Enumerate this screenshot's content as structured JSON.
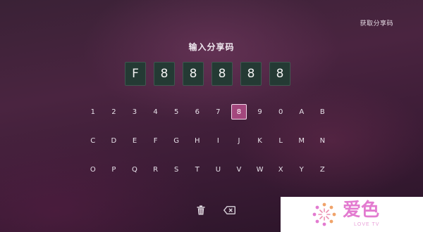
{
  "header": {
    "get_code_link": "获取分享码"
  },
  "title": "输入分享码",
  "code_boxes": [
    "F",
    "8",
    "8",
    "8",
    "8",
    "8"
  ],
  "keyboard": {
    "rows": [
      [
        "1",
        "2",
        "3",
        "4",
        "5",
        "6",
        "7",
        "8",
        "9",
        "0",
        "A",
        "B"
      ],
      [
        "C",
        "D",
        "E",
        "F",
        "G",
        "H",
        "I",
        "J",
        "K",
        "L",
        "M",
        "N"
      ],
      [
        "O",
        "P",
        "Q",
        "R",
        "S",
        "T",
        "U",
        "V",
        "W",
        "X",
        "Y",
        "Z"
      ]
    ],
    "selected_key": "8"
  },
  "actions": {
    "delete_icon": "trash-icon",
    "backspace_icon": "backspace-icon"
  },
  "logo": {
    "text": "爱色",
    "subtext": "LOVE TV",
    "icon": "sunburst-icon",
    "color": "#e37bd0"
  },
  "colors": {
    "background": "#3c1c36",
    "code_box": "#243a34",
    "selected_key": "#a3477d"
  }
}
